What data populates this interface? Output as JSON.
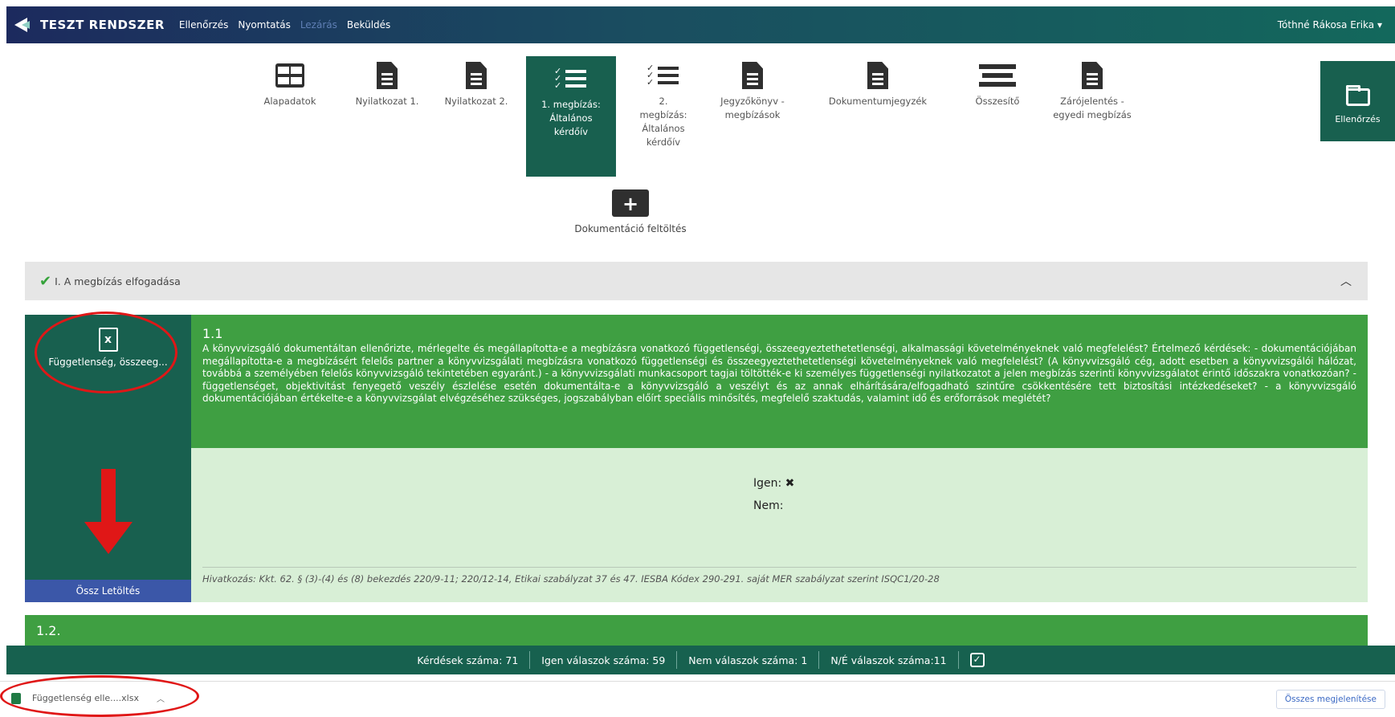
{
  "header": {
    "brand": "TESZT RENDSZER",
    "nav": [
      "Ellenőrzés",
      "Nyomtatás",
      "Lezárás",
      "Beküldés"
    ],
    "user": "Tóthné Rákosa Erika"
  },
  "tools": [
    {
      "label": "Alapadatok",
      "icon": "grid-icon"
    },
    {
      "label": "Nyilatkozat 1.",
      "icon": "document-icon"
    },
    {
      "label": "Nyilatkozat 2.",
      "icon": "document-icon"
    },
    {
      "label": "1. megbízás: Általános kérdőív",
      "icon": "checklist-icon",
      "active": true
    },
    {
      "label": "2. megbízás: Általános kérdőív",
      "icon": "checklist-icon"
    },
    {
      "label": "Jegyzőkönyv - megbízások",
      "icon": "document-icon"
    },
    {
      "label": "Dokumentumjegyzék",
      "icon": "document-icon"
    },
    {
      "label": "Összesítő",
      "icon": "lines-icon"
    },
    {
      "label": "Zárójelentés - egyedi megbízás",
      "icon": "document-icon"
    }
  ],
  "side_button": {
    "label": "Ellenőrzés",
    "icon": "folder-icon"
  },
  "upload": {
    "label": "Dokumentáció feltöltés",
    "icon": "folder-plus-icon"
  },
  "section": {
    "title": "I. A megbízás elfogadása",
    "status_icon": "check-icon"
  },
  "question": {
    "number": "1.1",
    "text": "A könyvvizsgáló dokumentáltan ellenőrizte, mérlegelte és megállapította-e a megbízásra vonatkozó függetlenségi, összeegyeztethetetlenségi, alkalmassági követelményeknek való megfelelést? Értelmező kérdések: - dokumentációjában megállapította-e a megbízásért felelős partner a könyvvizsgálati megbízásra vonatkozó függetlenségi és összeegyeztethetetlenségi követelményeknek való megfelelést? (A könyvvizsgáló cég, adott esetben a könyvvizsgálói hálózat, továbbá a személyében felelős könyvvizsgáló tekintetében egyaránt.) - a könyvvizsgálati munkacsoport tagjai töltötték-e ki személyes függetlenségi nyilatkozatot a jelen megbízás szerinti könyvvizsgálatot érintő időszakra vonatkozóan? - függetlenséget, objektivitást fenyegető veszély észlelése esetén dokumentálta-e a könyvvizsgáló a veszélyt és az annak elhárítására/elfogadható szintűre csökkentésére tett biztosítási intézkedéseket? - a könyvvizsgáló dokumentációjában értékelte-e a könyvvizsgálat elvégzéséhez szükséges, jogszabályban előírt speciális minősítés, megfelelő szaktudás, valamint idő és erőforrások meglétét?",
    "file_label": "Függetlenség, összeeg...",
    "download_all": "Össz Letöltés",
    "answers": {
      "yes_label": "Igen:",
      "yes_mark": "✖",
      "no_label": "Nem:"
    },
    "reference": "Hivatkozás: Kkt. 62. § (3)-(4) és (8) bekezdés 220/9-11; 220/12-14, Etikai szabályzat 37 és 47. IESBA Kódex 290-291. saját MER szabályzat szerint ISQC1/20-28"
  },
  "next_question": {
    "number": "1.2."
  },
  "footer": {
    "questions": "Kérdések száma: 71",
    "yes": "Igen válaszok száma: 59",
    "no": "Nem válaszok száma: 1",
    "na": "N/É válaszok száma:11",
    "check": "☑"
  },
  "download_bar": {
    "file": "Függetlenség elle....xlsx",
    "show_all": "Összes megjelenítése"
  }
}
